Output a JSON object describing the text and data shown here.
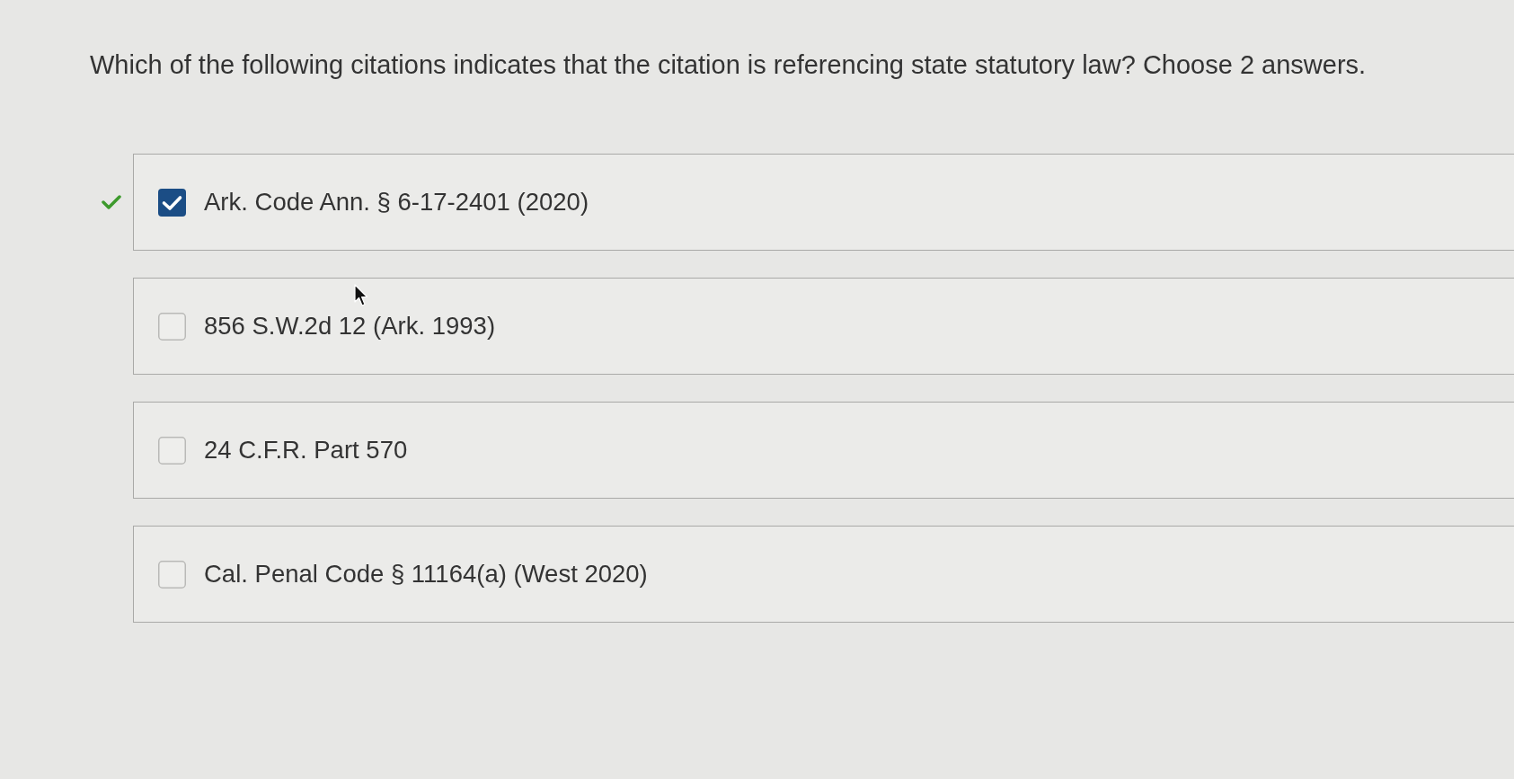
{
  "question": {
    "text": "Which of the following citations indicates that the citation is referencing state statutory law? Choose 2 answers."
  },
  "options": [
    {
      "label": "Ark. Code Ann. § 6-17-2401 (2020)",
      "checked": true,
      "correct_mark": true
    },
    {
      "label": "856 S.W.2d 12 (Ark. 1993)",
      "checked": false,
      "correct_mark": false
    },
    {
      "label": "24 C.F.R. Part 570",
      "checked": false,
      "correct_mark": false
    },
    {
      "label": "Cal. Penal Code § 11164(a) (West 2020)",
      "checked": false,
      "correct_mark": false
    }
  ]
}
